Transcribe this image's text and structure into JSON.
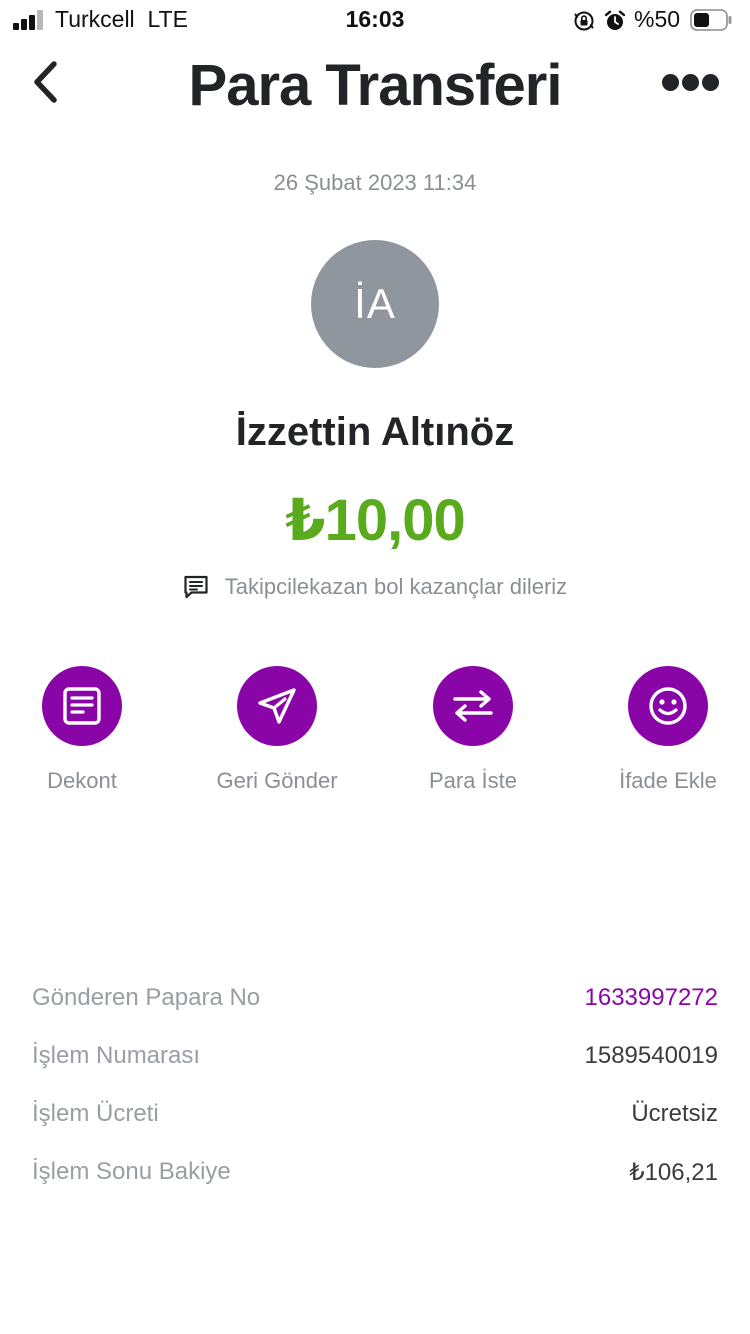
{
  "status_bar": {
    "carrier": "Turkcell",
    "network": "LTE",
    "time": "16:03",
    "battery_percent": "%50",
    "battery_level": 0.5,
    "icons": [
      "orientation-lock-icon",
      "alarm-icon"
    ]
  },
  "header": {
    "title": "Para Transferi",
    "back_icon": "chevron-left-icon",
    "more_icon": "more-horizontal-icon"
  },
  "transaction": {
    "date": "26 Şubat 2023 11:34",
    "avatar_initials": "İA",
    "recipient_name": "İzzettin Altınöz",
    "amount": "₺10,00",
    "note_icon": "message-icon",
    "note": "Takipcilekazan bol kazançlar dileriz"
  },
  "actions": [
    {
      "label": "Dekont",
      "icon": "receipt-icon"
    },
    {
      "label": "Geri Gönder",
      "icon": "send-icon"
    },
    {
      "label": "Para İste",
      "icon": "transfer-arrows-icon"
    },
    {
      "label": "İfade Ekle",
      "icon": "smiley-icon"
    }
  ],
  "details": [
    {
      "label": "Gönderen Papara No",
      "value": "1633997272"
    },
    {
      "label": "İşlem Numarası",
      "value": "1589540019"
    },
    {
      "label": "İşlem Ücreti",
      "value": "Ücretsiz"
    },
    {
      "label": "İşlem Sonu Bakiye",
      "value": "₺106,21"
    }
  ],
  "colors": {
    "accent": "#8a05a8",
    "amount": "#5aaa1e",
    "avatar": "#8f969d",
    "muted_text": "#8b8f95"
  }
}
